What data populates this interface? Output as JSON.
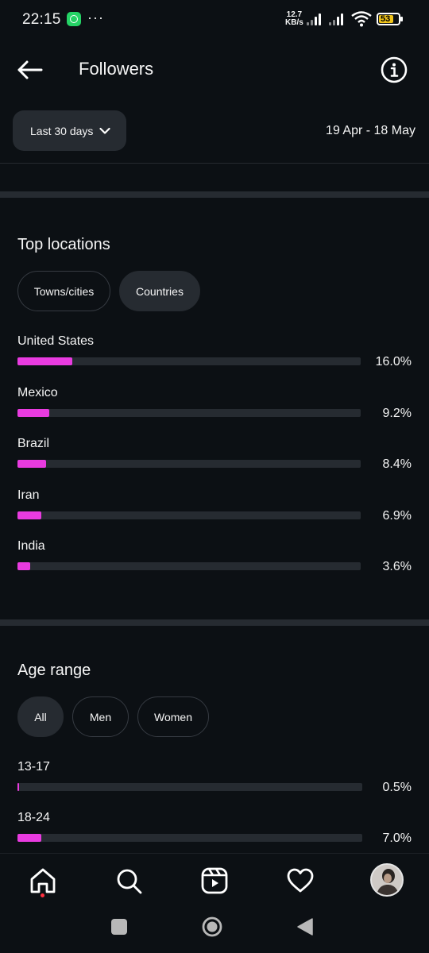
{
  "status_bar": {
    "time": "22:15",
    "dots": "···",
    "net_speed_value": "12.7",
    "net_speed_unit": "KB/s",
    "battery": "53",
    "battery_color": "#f0c419"
  },
  "header": {
    "title": "Followers",
    "back_icon": "arrow-left-icon",
    "info_icon": "info-circle-icon"
  },
  "filters": {
    "range_label": "Last 30 days",
    "date_range": "19 Apr - 18 May"
  },
  "locations": {
    "title": "Top locations",
    "tabs": [
      {
        "label": "Towns/cities",
        "active": false
      },
      {
        "label": "Countries",
        "active": true
      }
    ],
    "items": [
      {
        "label": "United States",
        "value": "16.0%",
        "percent": 16.0
      },
      {
        "label": "Mexico",
        "value": "9.2%",
        "percent": 9.2
      },
      {
        "label": "Brazil",
        "value": "8.4%",
        "percent": 8.4
      },
      {
        "label": "Iran",
        "value": "6.9%",
        "percent": 6.9
      },
      {
        "label": "India",
        "value": "3.6%",
        "percent": 3.6
      }
    ]
  },
  "age": {
    "title": "Age range",
    "tabs": [
      {
        "label": "All",
        "active": true
      },
      {
        "label": "Men",
        "active": false
      },
      {
        "label": "Women",
        "active": false
      }
    ],
    "items": [
      {
        "label": "13-17",
        "value": "0.5%",
        "percent": 0.5
      },
      {
        "label": "18-24",
        "value": "7.0%",
        "percent": 7.0
      }
    ]
  },
  "colors": {
    "accent": "#e93be0",
    "background": "#0c1014",
    "track": "#262b31",
    "notification_dot": "#ff3040"
  },
  "bottom_nav": [
    "home-icon",
    "search-icon",
    "reels-icon",
    "heart-icon",
    "profile-avatar"
  ],
  "system_nav": [
    "recents-square-icon",
    "home-circle-icon",
    "back-triangle-icon"
  ]
}
